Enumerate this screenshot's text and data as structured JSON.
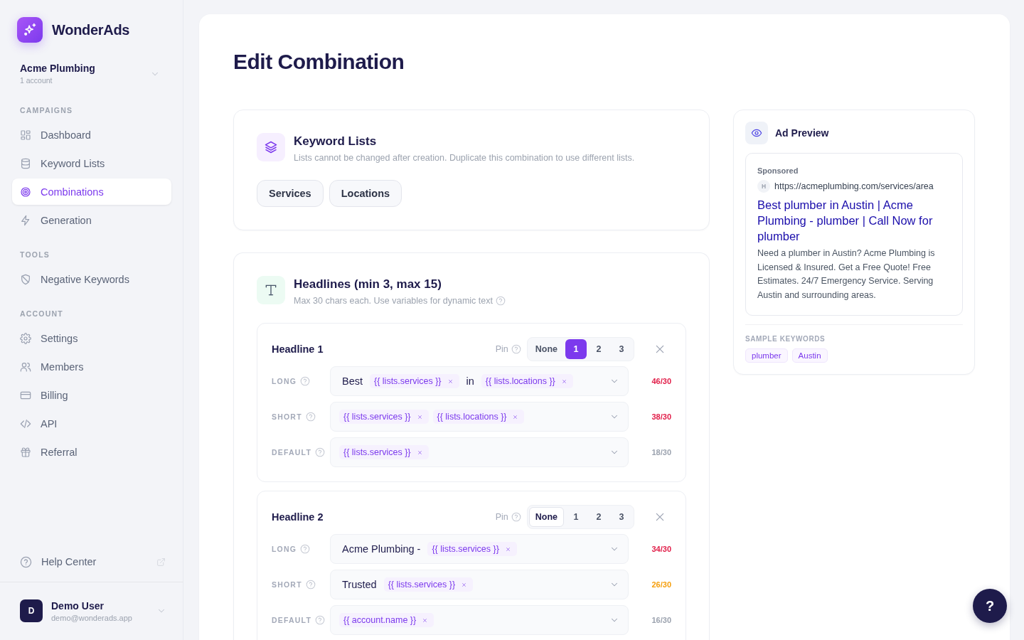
{
  "brand": {
    "name": "WonderAds"
  },
  "account": {
    "name": "Acme Plumbing",
    "subtitle": "1 account"
  },
  "nav_sections": [
    {
      "title": "CAMPAIGNS",
      "items": [
        {
          "label": "Dashboard",
          "selected": false
        },
        {
          "label": "Keyword Lists",
          "selected": false
        },
        {
          "label": "Combinations",
          "selected": true
        },
        {
          "label": "Generation",
          "selected": false
        }
      ]
    },
    {
      "title": "TOOLS",
      "items": [
        {
          "label": "Negative Keywords",
          "selected": false
        }
      ]
    },
    {
      "title": "ACCOUNT",
      "items": [
        {
          "label": "Settings",
          "selected": false
        },
        {
          "label": "Members",
          "selected": false
        },
        {
          "label": "Billing",
          "selected": false
        },
        {
          "label": "API",
          "selected": false
        },
        {
          "label": "Referral",
          "selected": false
        }
      ]
    }
  ],
  "help_center": {
    "label": "Help Center"
  },
  "user": {
    "initial": "D",
    "name": "Demo User",
    "email": "demo@wonderads.app"
  },
  "page_title": "Edit Combination",
  "keyword_lists": {
    "title": "Keyword Lists",
    "description": "Lists cannot be changed after creation. Duplicate this combination to use different lists.",
    "lists": [
      "Services",
      "Locations"
    ]
  },
  "headlines": {
    "title": "Headlines (min 3, max 15)",
    "description": "Max 30 chars each. Use variables for dynamic text",
    "items": [
      {
        "title": "Headline 1",
        "pin_label": "Pin",
        "pin_options": [
          {
            "label": "None",
            "selected": false
          },
          {
            "label": "1",
            "selected": true
          },
          {
            "label": "2",
            "selected": false
          },
          {
            "label": "3",
            "selected": false
          }
        ],
        "fields": [
          {
            "label": "LONG",
            "parts": [
              {
                "kind": "text",
                "text": "Best"
              },
              {
                "kind": "variable",
                "text": "{{ lists.services }}"
              },
              {
                "kind": "text",
                "text": "in"
              },
              {
                "kind": "variable",
                "text": "{{ lists.locations }}"
              }
            ],
            "count": "46/30",
            "color": "#e11d48"
          },
          {
            "label": "SHORT",
            "parts": [
              {
                "kind": "variable",
                "text": "{{ lists.services }}"
              },
              {
                "kind": "variable",
                "text": "{{ lists.locations }}"
              }
            ],
            "count": "38/30",
            "color": "#e11d48"
          },
          {
            "label": "DEFAULT",
            "parts": [
              {
                "kind": "variable",
                "text": "{{ lists.services }}"
              }
            ],
            "count": "18/30",
            "color": "#9ca3af"
          }
        ]
      },
      {
        "title": "Headline 2",
        "pin_label": "Pin",
        "pin_options": [
          {
            "label": "None",
            "selected": true
          },
          {
            "label": "1",
            "selected": false
          },
          {
            "label": "2",
            "selected": false
          },
          {
            "label": "3",
            "selected": false
          }
        ],
        "fields": [
          {
            "label": "LONG",
            "parts": [
              {
                "kind": "text",
                "text": "Acme Plumbing -"
              },
              {
                "kind": "variable",
                "text": "{{ lists.services }}"
              }
            ],
            "count": "34/30",
            "color": "#e11d48"
          },
          {
            "label": "SHORT",
            "parts": [
              {
                "kind": "text",
                "text": "Trusted"
              },
              {
                "kind": "variable",
                "text": "{{ lists.services }}"
              }
            ],
            "count": "26/30",
            "color": "#f59e0b"
          },
          {
            "label": "DEFAULT",
            "parts": [
              {
                "kind": "variable",
                "text": "{{ account.name }}"
              }
            ],
            "count": "16/30",
            "color": "#9ca3af"
          }
        ]
      }
    ]
  },
  "ad_preview": {
    "title": "Ad Preview",
    "sponsored": "Sponsored",
    "favicon": "H",
    "url": "https://acmeplumbing.com/services/area",
    "headline": "Best plumber in Austin | Acme Plumbing - plumber | Call Now for plumber",
    "description": "Need a plumber in Austin? Acme Plumbing is Licensed & Insured. Get a Free Quote! Free Estimates. 24/7 Emergency Service. Serving Austin and surrounding areas.",
    "keywords_label": "SAMPLE KEYWORDS",
    "keywords": [
      "plumber",
      "Austin"
    ]
  },
  "help_button": {
    "label": "?"
  }
}
